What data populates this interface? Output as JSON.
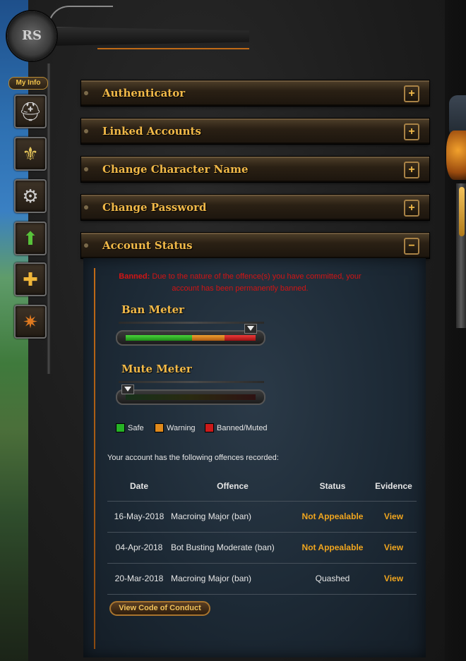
{
  "sidebar": {
    "my_info_label": "My Info",
    "icons": [
      {
        "name": "helmet-icon",
        "glyph": "⛑"
      },
      {
        "name": "banner-icon",
        "glyph": "⚜"
      },
      {
        "name": "gear-icon",
        "glyph": "⚙"
      },
      {
        "name": "upgrade-arrow-icon",
        "glyph": "⬆"
      },
      {
        "name": "add-friend-icon",
        "glyph": "👤"
      },
      {
        "name": "bomb-icon",
        "glyph": "✷"
      }
    ]
  },
  "accordion": [
    {
      "label": "Authenticator",
      "toggle": "+"
    },
    {
      "label": "Linked Accounts",
      "toggle": "+"
    },
    {
      "label": "Change Character Name",
      "toggle": "+"
    },
    {
      "label": "Change Password",
      "toggle": "+"
    },
    {
      "label": "Account Status",
      "toggle": "−"
    }
  ],
  "account_status": {
    "ban_prefix": "Banned:",
    "ban_message": "Due to the nature of the offence(s) you have committed, your account has been permanently banned.",
    "ban_meter": {
      "title": "Ban Meter",
      "level": 1.0
    },
    "mute_meter": {
      "title": "Mute Meter",
      "level": 0.0
    },
    "legend": [
      {
        "label": "Safe",
        "color": "#26b326"
      },
      {
        "label": "Warning",
        "color": "#e08a1c"
      },
      {
        "label": "Banned/Muted",
        "color": "#cc1a1a"
      }
    ],
    "offences_intro": "Your account has the following offences recorded:",
    "table": {
      "headers": {
        "date": "Date",
        "offence": "Offence",
        "status": "Status",
        "evidence": "Evidence"
      },
      "rows": [
        {
          "date": "16-May-2018",
          "offence": "Macroing Major (ban)",
          "status": "Not Appealable",
          "evidence": "View"
        },
        {
          "date": "04-Apr-2018",
          "offence": "Bot Busting Moderate (ban)",
          "status": "Not Appealable",
          "evidence": "View"
        },
        {
          "date": "20-Mar-2018",
          "offence": "Macroing Major (ban)",
          "status": "Quashed",
          "evidence": "View"
        }
      ]
    },
    "code_of_conduct_label": "View Code of Conduct"
  },
  "colors": {
    "accent_gold": "#f1b948",
    "ban_red": "#d21414",
    "status_orange": "#f0a51e"
  }
}
